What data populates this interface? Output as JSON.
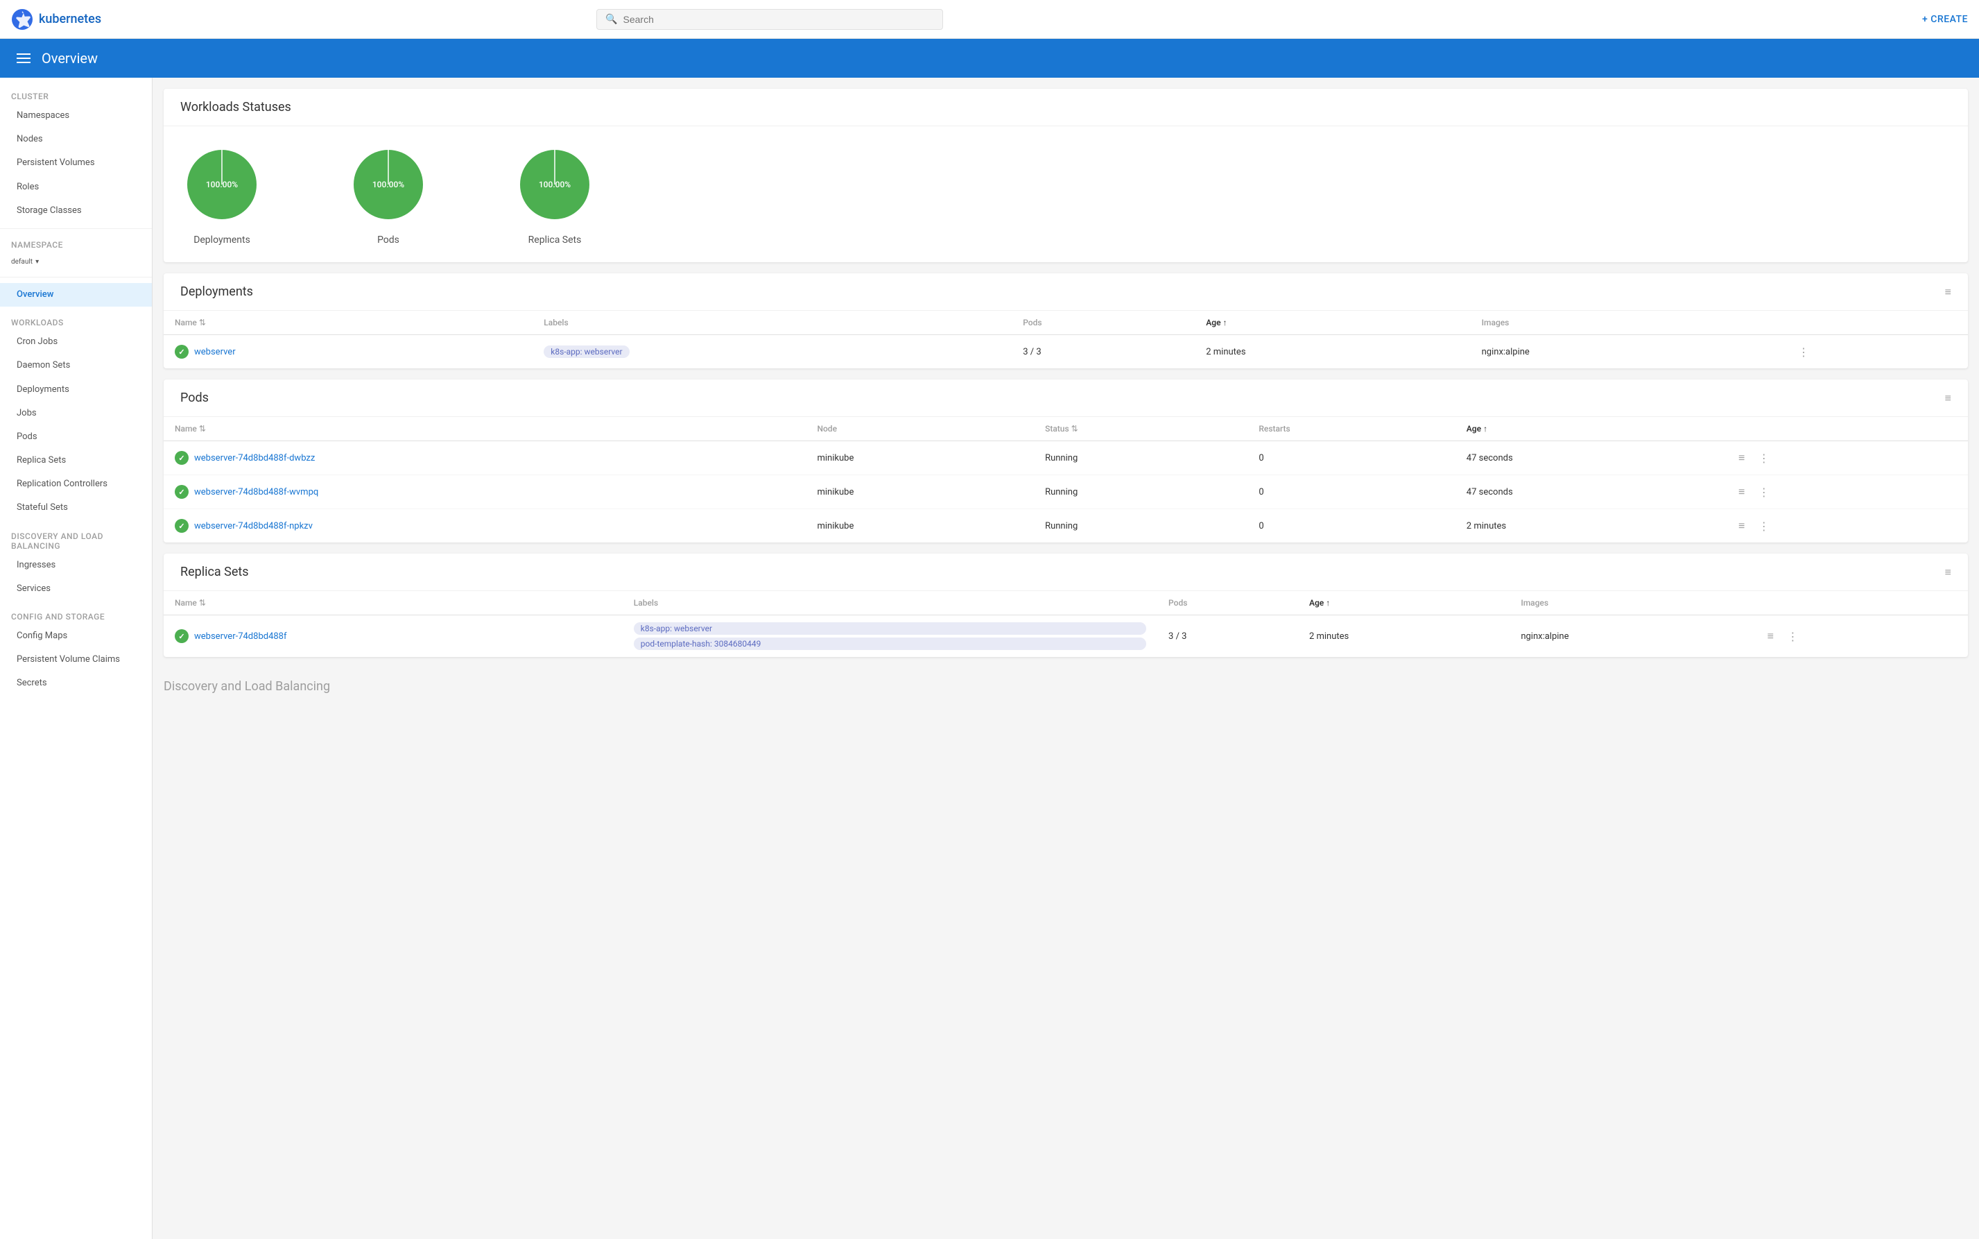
{
  "topbar": {
    "logo_text": "kubernetes",
    "search_placeholder": "Search",
    "create_label": "+ CREATE"
  },
  "header": {
    "title": "Overview"
  },
  "sidebar": {
    "cluster_section": "Cluster",
    "cluster_items": [
      "Namespaces",
      "Nodes",
      "Persistent Volumes",
      "Roles",
      "Storage Classes"
    ],
    "namespace_label": "Namespace",
    "namespace_value": "default",
    "active_item": "Overview",
    "workloads_section": "Workloads",
    "workloads_items": [
      "Cron Jobs",
      "Daemon Sets",
      "Deployments",
      "Jobs",
      "Pods",
      "Replica Sets",
      "Replication Controllers",
      "Stateful Sets"
    ],
    "discovery_section": "Discovery and Load Balancing",
    "discovery_items": [
      "Ingresses",
      "Services"
    ],
    "config_section": "Config and Storage",
    "config_items": [
      "Config Maps",
      "Persistent Volume Claims",
      "Secrets"
    ]
  },
  "workloads_statuses": {
    "title": "Workloads Statuses",
    "charts": [
      {
        "label": "Deployments",
        "value": "100.00%",
        "percent": 100
      },
      {
        "label": "Pods",
        "value": "100.00%",
        "percent": 100
      },
      {
        "label": "Replica Sets",
        "value": "100.00%",
        "percent": 100
      }
    ]
  },
  "deployments": {
    "title": "Deployments",
    "columns": [
      "Name",
      "Labels",
      "Pods",
      "Age",
      "Images"
    ],
    "rows": [
      {
        "name": "webserver",
        "labels": [
          "k8s-app: webserver"
        ],
        "pods": "3 / 3",
        "age": "2 minutes",
        "images": "nginx:alpine"
      }
    ]
  },
  "pods": {
    "title": "Pods",
    "columns": [
      "Name",
      "Node",
      "Status",
      "Restarts",
      "Age"
    ],
    "rows": [
      {
        "name": "webserver-74d8bd488f-dwbzz",
        "node": "minikube",
        "status": "Running",
        "restarts": "0",
        "age": "47 seconds"
      },
      {
        "name": "webserver-74d8bd488f-wvmpq",
        "node": "minikube",
        "status": "Running",
        "restarts": "0",
        "age": "47 seconds"
      },
      {
        "name": "webserver-74d8bd488f-npkzv",
        "node": "minikube",
        "status": "Running",
        "restarts": "0",
        "age": "2 minutes"
      }
    ]
  },
  "replica_sets": {
    "title": "Replica Sets",
    "columns": [
      "Name",
      "Labels",
      "Pods",
      "Age",
      "Images"
    ],
    "rows": [
      {
        "name": "webserver-74d8bd488f",
        "labels": [
          "k8s-app: webserver",
          "pod-template-hash: 3084680449"
        ],
        "pods": "3 / 3",
        "age": "2 minutes",
        "images": "nginx:alpine"
      }
    ]
  },
  "discovery_section_title": "Discovery and Load Balancing",
  "icons": {
    "menu": "☰",
    "search": "🔍",
    "filter": "≡",
    "more": "⋮",
    "list": "≡",
    "check": "✓",
    "dropdown": "▾",
    "plus": "+"
  }
}
